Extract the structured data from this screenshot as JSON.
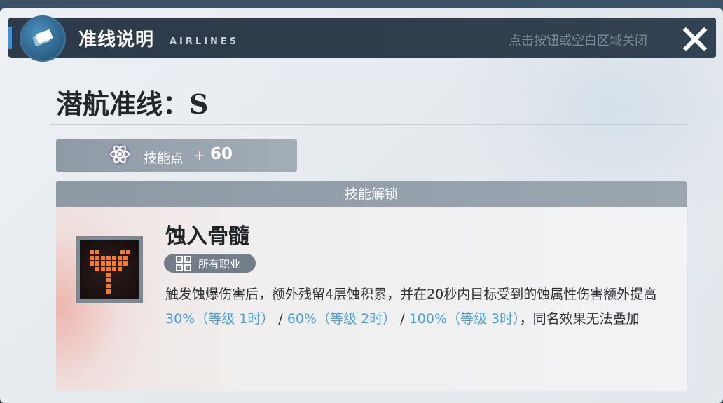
{
  "header": {
    "title": "准线说明",
    "title_en": "AIRLINES",
    "close_hint": "点击按钮或空白区域关闭",
    "close_icon": "close-x-icon"
  },
  "heading": "潜航准线：S",
  "skill_points": {
    "icon": "atom-icon",
    "label": "技能点",
    "plus": "+",
    "value": "60"
  },
  "unlock": {
    "header": "技能解锁",
    "skill": {
      "name": "蚀入骨髓",
      "icon": "hammer-skill-icon",
      "tag_icon": "class-grid-icon",
      "tag": "所有职业",
      "desc_part1": "触发蚀爆伤害后，额外残留4层蚀积累，并在20秒内目标受到的蚀属性伤害额外提高 ",
      "lv1": "30%（等级 1时）",
      "sep1": " / ",
      "lv2": "60%（等级 2时）",
      "sep2": " / ",
      "lv3": "100%（等级 3时）",
      "desc_part2": "，同名效果无法叠加"
    }
  },
  "colors": {
    "title_bar": "#2f3d4c",
    "accent": "#3d8fd6",
    "highlight": "#4a9ed8",
    "skill_glow": "#ff6a1a"
  }
}
